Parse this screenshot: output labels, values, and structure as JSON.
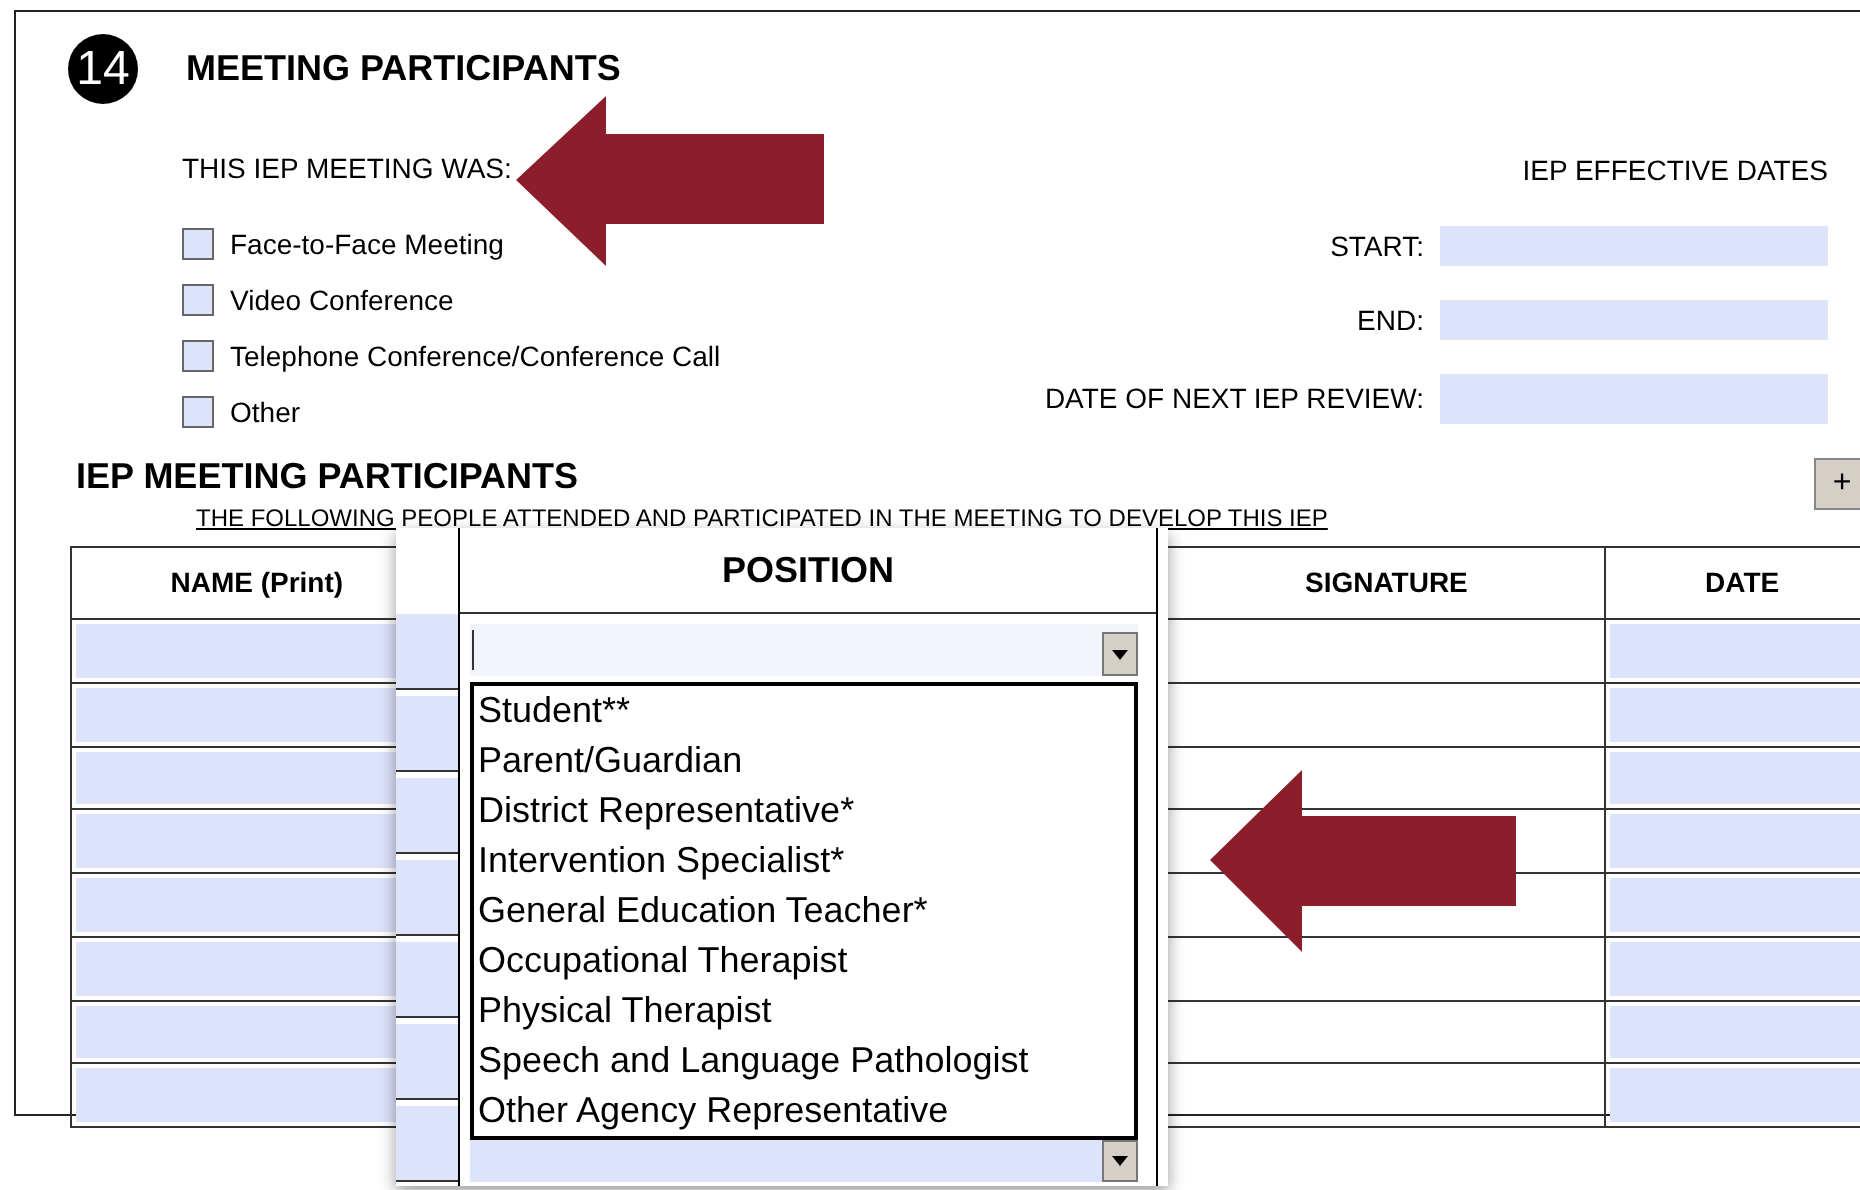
{
  "section": {
    "number": "14",
    "title": "MEETING PARTICIPANTS"
  },
  "meeting_type": {
    "label": "THIS IEP MEETING WAS:",
    "options": [
      {
        "label": "Face-to-Face Meeting",
        "checked": false
      },
      {
        "label": "Video Conference",
        "checked": false
      },
      {
        "label": "Telephone Conference/Conference Call",
        "checked": false
      },
      {
        "label": "Other",
        "checked": false
      }
    ]
  },
  "effective_dates": {
    "title": "IEP EFFECTIVE DATES",
    "fields": [
      {
        "label": "START:"
      },
      {
        "label": "END:"
      },
      {
        "label": "DATE OF NEXT IEP REVIEW:"
      }
    ]
  },
  "participants": {
    "title": "IEP MEETING PARTICIPANTS",
    "subtitle": "THE FOLLOWING PEOPLE ATTENDED AND PARTICIPATED IN THE MEETING TO DEVELOP THIS IEP",
    "add_button": "+",
    "columns": [
      {
        "label": "NAME (Print)",
        "kind": "field"
      },
      {
        "label": "SIGNATURE",
        "kind": "blank"
      },
      {
        "label": "DATE",
        "kind": "field"
      }
    ]
  },
  "position_dropdown": {
    "header": "POSITION",
    "expanded": true,
    "options": [
      {
        "label": "Student**"
      },
      {
        "label": "Parent/Guardian"
      },
      {
        "label": "District Representative*"
      },
      {
        "label": "Intervention Specialist*"
      },
      {
        "label": "General Education Teacher*"
      },
      {
        "label": "Occupational Therapist"
      },
      {
        "label": "Physical Therapist"
      },
      {
        "label": "Speech and Language Pathologist"
      },
      {
        "label": "Other Agency Representative"
      }
    ]
  }
}
